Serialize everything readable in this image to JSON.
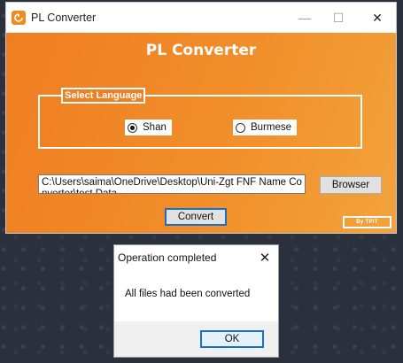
{
  "main_window": {
    "title": "PL Converter",
    "heading": "PL Converter",
    "group_label": "Select Language",
    "options": [
      {
        "label": "Shan",
        "checked": true
      },
      {
        "label": "Burmese",
        "checked": false
      }
    ],
    "path_value": "C:\\Users\\saima\\OneDrive\\Desktop\\Uni-Zgt FNF Name Converter\\test Data",
    "browse_label": "Browser",
    "convert_label": "Convert",
    "credit": "By TPIT",
    "controls": {
      "minimize": "—",
      "maximize": "☐",
      "close": "✕"
    }
  },
  "dialog": {
    "title": "Operation completed",
    "message": "All files had been converted",
    "ok_label": "OK",
    "close_glyph": "✕"
  },
  "colors": {
    "accent": "#f07d22",
    "accent_light": "#f3a33c",
    "focus_border": "#1a6fc6",
    "desktop": "#2b313c"
  }
}
